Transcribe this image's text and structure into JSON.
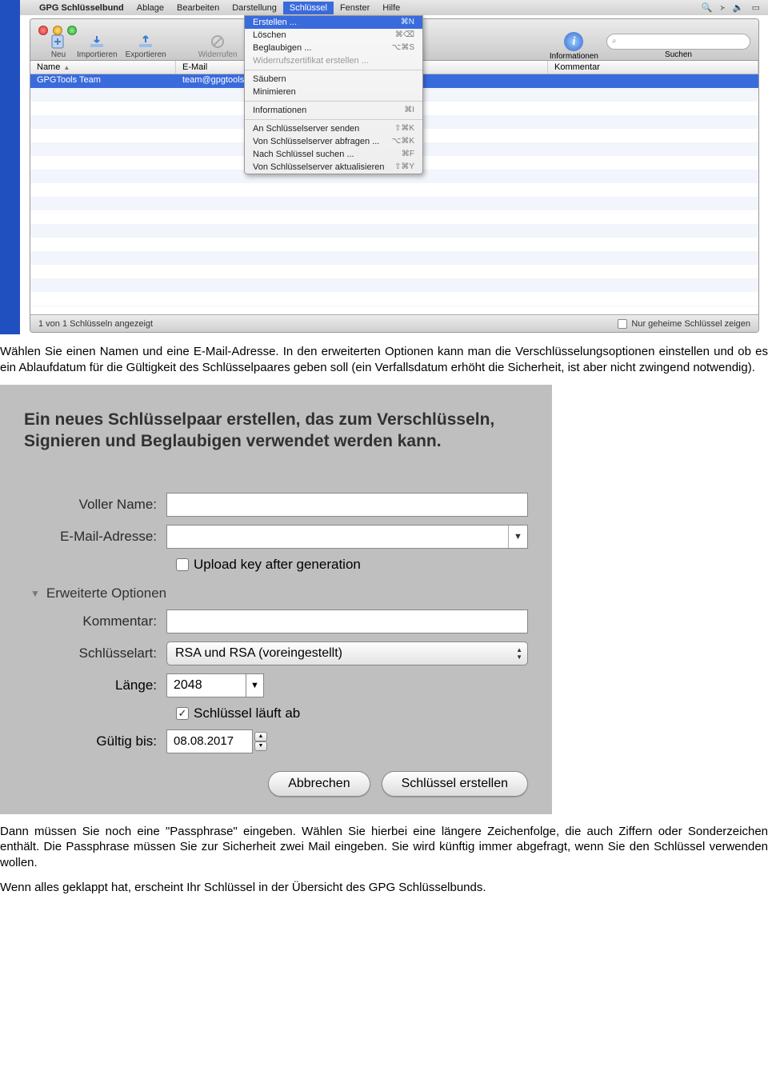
{
  "menubar": {
    "app": "GPG Schlüsselbund",
    "items": [
      "Ablage",
      "Bearbeiten",
      "Darstellung",
      "Schlüssel",
      "Fenster",
      "Hilfe"
    ],
    "active_index": 3
  },
  "toolbar": {
    "new": "Neu",
    "import": "Importieren",
    "export": "Exportieren",
    "revoke": "Widerrufen",
    "info": "Informationen",
    "search_label": "Suchen",
    "search_placeholder": "Q"
  },
  "table": {
    "headers": [
      "Name",
      "E-Mail",
      "",
      "Kommentar"
    ],
    "row": {
      "name": "GPGTools Team",
      "email": "team@gpgtools.org"
    }
  },
  "menu": [
    {
      "label": "Erstellen ...",
      "shortcut": "⌘N",
      "selected": true
    },
    {
      "label": "Löschen",
      "shortcut": "⌘⌫"
    },
    {
      "label": "Beglaubigen ...",
      "shortcut": "⌥⌘S"
    },
    {
      "label": "Widerrufszertifikat erstellen ...",
      "disabled": true
    },
    {
      "sep": true
    },
    {
      "label": "Säubern"
    },
    {
      "label": "Minimieren"
    },
    {
      "sep": true
    },
    {
      "label": "Informationen",
      "shortcut": "⌘I"
    },
    {
      "sep": true
    },
    {
      "label": "An Schlüsselserver senden",
      "shortcut": "⇧⌘K"
    },
    {
      "label": "Von Schlüsselserver abfragen ...",
      "shortcut": "⌥⌘K"
    },
    {
      "label": "Nach Schlüssel suchen ...",
      "shortcut": "⌘F"
    },
    {
      "label": "Von Schlüsselserver aktualisieren",
      "shortcut": "⇧⌘Y"
    }
  ],
  "status": {
    "left": "1 von 1 Schlüsseln angezeigt",
    "right": "Nur geheime Schlüssel zeigen"
  },
  "para1_title": "Wählen Sie einen Namen und eine E-Mail-Adresse.",
  "para1_body": " In den erweiterten Optionen kann man die Verschlüsselungsoptionen einstellen und ob es ein Ablaufdatum für die Gültigkeit des Schlüsselpaares geben soll (ein Verfallsdatum erhöht die Sicherheit, ist aber nicht zwingend notwendig).",
  "dialog": {
    "title": "Ein neues Schlüsselpaar erstellen, das zum Verschlüsseln, Signieren und Beglaubigen verwendet werden kann.",
    "labels": {
      "name": "Voller Name:",
      "email": "E-Mail-Adresse:",
      "upload": "Upload key after generation",
      "expand": "Erweiterte Optionen",
      "comment": "Kommentar:",
      "keytype": "Schlüsselart:",
      "length": "Länge:",
      "expires_chk": "Schlüssel läuft ab",
      "valid": "Gültig bis:"
    },
    "values": {
      "keytype": "RSA und RSA (voreingestellt)",
      "length": "2048",
      "valid": "08.08.2017"
    },
    "buttons": {
      "cancel": "Abbrechen",
      "create": "Schlüssel erstellen"
    }
  },
  "para2": "Dann müssen Sie noch eine \"Passphrase\" eingeben. Wählen Sie hierbei eine längere Zeichenfolge, die auch Ziffern oder Sonderzeichen enthält. Die Passphrase müssen Sie zur Sicherheit zwei Mail eingeben. Sie wird künftig immer abgefragt, wenn Sie den Schlüssel verwenden wollen.",
  "para3": "Wenn alles geklappt hat, erscheint Ihr Schlüssel in der Übersicht des GPG Schlüsselbunds."
}
